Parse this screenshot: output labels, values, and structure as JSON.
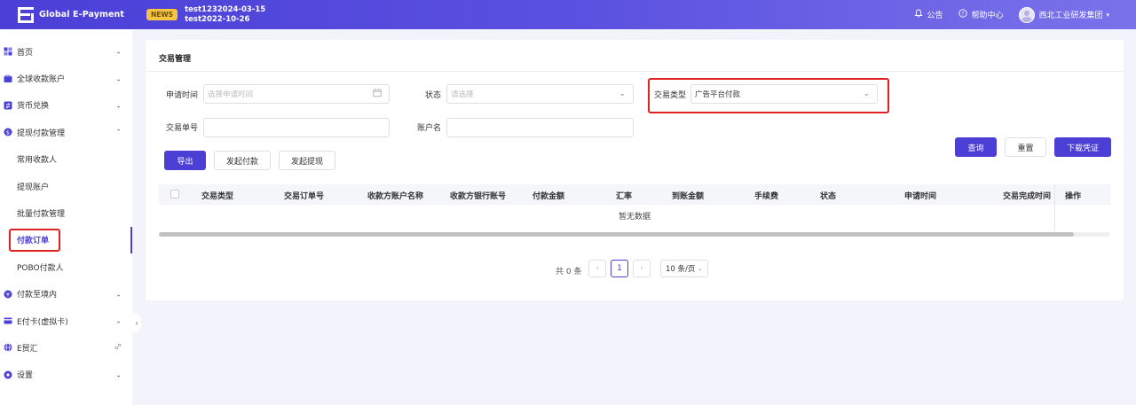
{
  "header": {
    "logo_title": "Global E-Payment",
    "news_badge": "NEWS",
    "news_line1": "test1232024-03-15",
    "news_line2": "test2022-10-26",
    "announcement": "公告",
    "help_center": "帮助中心",
    "user_name": "西北工业研发集团"
  },
  "sidebar": {
    "items": [
      {
        "label": "首页",
        "icon": "grid-icon",
        "chevron": "⌄"
      },
      {
        "label": "全球收款账户",
        "icon": "wallet-icon",
        "chevron": "⌄"
      },
      {
        "label": "货币兑换",
        "icon": "exchange-icon",
        "chevron": "⌄"
      },
      {
        "label": "提现付款管理",
        "icon": "withdraw-icon",
        "chevron": "⌃"
      }
    ],
    "sub_items": [
      "常用收款人",
      "提现账户",
      "批量付款管理",
      "付款订单",
      "POBO付款人"
    ],
    "items_after": [
      {
        "label": "付款至境内",
        "icon": "yen-icon",
        "chevron": "⌄"
      },
      {
        "label": "E付卡(虚拟卡)",
        "icon": "card-icon",
        "chevron": "⌄"
      },
      {
        "label": "E贸汇",
        "icon": "globe-icon",
        "chevron": "🔗"
      },
      {
        "label": "设置",
        "icon": "gear-icon",
        "chevron": "⌄"
      }
    ],
    "collapse_glyph": "‹"
  },
  "panel": {
    "title": "交易管理",
    "filters": {
      "apply_time_label": "申请时间",
      "apply_time_placeholder": "选择申请时间",
      "status_label": "状态",
      "status_placeholder": "请选择",
      "type_label": "交易类型",
      "type_value": "广告平台付款",
      "order_no_label": "交易单号",
      "account_name_label": "账户名"
    },
    "buttons": {
      "export": "导出",
      "initiate_payment": "发起付款",
      "initiate_withdraw": "发起提现",
      "query": "查询",
      "reset": "重置",
      "download_voucher": "下载凭证"
    },
    "table": {
      "columns": [
        "交易类型",
        "交易订单号",
        "收款方账户名称",
        "收款方银行账号",
        "付款金额",
        "汇率",
        "到账金额",
        "手续费",
        "状态",
        "申请时间",
        "交易完成时间",
        "操作"
      ],
      "empty_text": "暂无数据"
    },
    "pagination": {
      "total": "共 0 条",
      "prev": "‹",
      "current_page": "1",
      "next": "›",
      "page_size": "10 条/页"
    }
  }
}
